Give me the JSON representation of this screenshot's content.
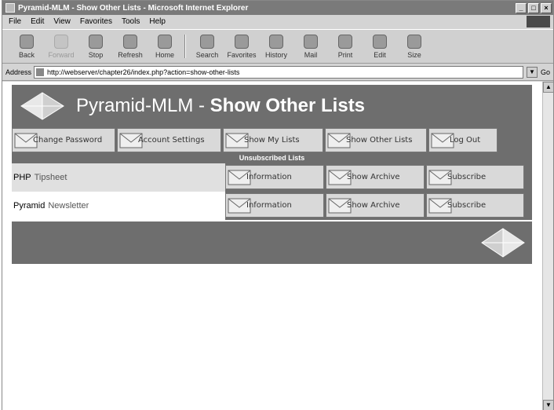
{
  "window": {
    "title": "Pyramid-MLM - Show Other Lists - Microsoft Internet Explorer",
    "controls": [
      "_",
      "□",
      "×"
    ]
  },
  "menu": [
    "File",
    "Edit",
    "View",
    "Favorites",
    "Tools",
    "Help"
  ],
  "toolbar": [
    {
      "label": "Back",
      "icon": "back-arrow-icon",
      "enabled": true
    },
    {
      "label": "Forward",
      "icon": "forward-arrow-icon",
      "enabled": false
    },
    {
      "label": "Stop",
      "icon": "stop-icon",
      "enabled": true
    },
    {
      "label": "Refresh",
      "icon": "refresh-icon",
      "enabled": true
    },
    {
      "label": "Home",
      "icon": "home-icon",
      "enabled": true
    },
    {
      "label": "Search",
      "icon": "search-icon",
      "enabled": true
    },
    {
      "label": "Favorites",
      "icon": "favorites-icon",
      "enabled": true
    },
    {
      "label": "History",
      "icon": "history-icon",
      "enabled": true
    },
    {
      "label": "Mail",
      "icon": "mail-icon",
      "enabled": true
    },
    {
      "label": "Print",
      "icon": "print-icon",
      "enabled": true
    },
    {
      "label": "Edit",
      "icon": "edit-icon",
      "enabled": true
    },
    {
      "label": "Size",
      "icon": "text-size-icon",
      "enabled": true
    }
  ],
  "address": {
    "label": "Address",
    "url": "http://webserver/chapter26/index.php?action=show-other-lists",
    "go": "Go"
  },
  "page": {
    "title_prefix": "Pyramid-MLM - ",
    "title_bold": "Show Other Lists",
    "nav": [
      "Change Password",
      "Account Settings",
      "Show My Lists",
      "Show Other Lists",
      "Log Out"
    ],
    "section_title": "Unsubscribed Lists",
    "lists": [
      {
        "name_first": "PHP",
        "name_second": "Tipsheet",
        "actions": [
          "Information",
          "Show Archive",
          "Subscribe"
        ]
      },
      {
        "name_first": "Pyramid",
        "name_second": "Newsletter",
        "actions": [
          "Information",
          "Show Archive",
          "Subscribe"
        ]
      }
    ]
  },
  "colors": {
    "banner": "#6e6e6e",
    "button": "#d9d9d9",
    "row_alt": "#e0e0e0"
  }
}
